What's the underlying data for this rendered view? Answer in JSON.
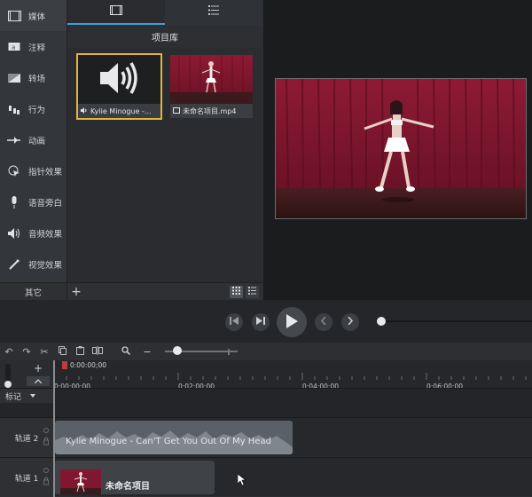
{
  "sidebar": {
    "items": [
      {
        "label": "媒体",
        "icon": "film-icon"
      },
      {
        "label": "注释",
        "icon": "annotation-icon"
      },
      {
        "label": "转场",
        "icon": "transition-icon"
      },
      {
        "label": "行为",
        "icon": "behavior-icon"
      },
      {
        "label": "动画",
        "icon": "animation-icon"
      },
      {
        "label": "指针效果",
        "icon": "cursor-effect-icon"
      },
      {
        "label": "语音旁白",
        "icon": "microphone-icon"
      },
      {
        "label": "音频效果",
        "icon": "speaker-icon"
      },
      {
        "label": "视觉效果",
        "icon": "magic-wand-icon"
      }
    ],
    "other_label": "其它"
  },
  "library": {
    "title": "项目库",
    "items": [
      {
        "label": "Kylie Minogue -...",
        "type": "audio"
      },
      {
        "label": "未命名项目.mp4",
        "type": "video"
      }
    ]
  },
  "timeline": {
    "playhead_time": "0:00:00;00",
    "ruler_ticks": [
      "0:00:00;00",
      "0:02:00;00",
      "0:04:00;00",
      "0:06:00;00"
    ],
    "markers_label": "标记",
    "tracks": [
      {
        "label": "轨道 2",
        "clip": "Kylie Minogue - Can'T Get You Out Of My Head"
      },
      {
        "label": "轨道 1",
        "clip": "未命名项目"
      }
    ]
  },
  "colors": {
    "accent": "#3f9fd8",
    "selection": "#e3b341",
    "curtain": "#7a1428"
  }
}
